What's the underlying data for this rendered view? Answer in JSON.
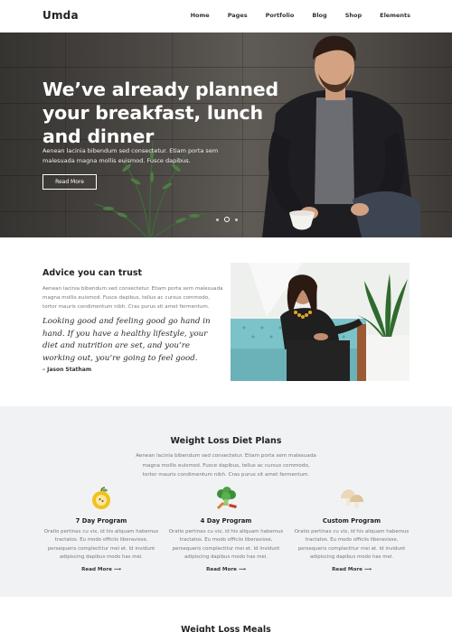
{
  "header": {
    "logo": "Umda",
    "nav": [
      "Home",
      "Pages",
      "Portfolio",
      "Blog",
      "Shop",
      "Elements"
    ]
  },
  "hero": {
    "title": "We’ve already planned your breakfast, lunch and dinner",
    "text": "Aenean lacinia bibendum sed consectetur. Etiam porta sem malesuada magna mollis euismod. Fusce dapibus.",
    "button": "Read More",
    "slides_total": 3,
    "slide_active": 2
  },
  "advice": {
    "title": "Advice you can trust",
    "text": "Aenean lacinia bibendum sed consectetur. Etiam porta sem malesuada magna mollis euismod. Fusce dapibus, tellus ac cursus commodo, tortor mauris condimentum nibh. Cras purus sit amet fermentum.",
    "quote": "Looking good and feeling good go hand in hand. If you have a healthy lifestyle, your diet and nutrition are set, and you’re working out, you’re going to feel good.",
    "author": "– Jason Statham"
  },
  "plans": {
    "title": "Weight Loss Diet Plans",
    "text": "Aenean lacinia bibendum sed consectetur. Etiam porta sem malesuada magna mollis euismod. Fusce dapibus, tellus ac cursus commodo, tortor mauris condimentum nibh. Cras purus sit amet fermentum.",
    "items": [
      {
        "icon": "apple-icon",
        "title": "7 Day Program",
        "text": "Oratio pertinax cu vix, id his aliquam habemus tractatos. Eu modo officiis liberavisse, persequeris complectitur mei et. Id invidunt adipiscing dapibus modo has mei.",
        "link": "Read More"
      },
      {
        "icon": "broccoli-icon",
        "title": "4 Day Program",
        "text": "Oratio pertinax cu vix, id his aliquam habemus tractatos. Eu modo officiis liberavisse, persequeris complectitur mei et. Id invidunt adipiscing dapibus modo has mei.",
        "link": "Read More"
      },
      {
        "icon": "mushroom-icon",
        "title": "Custom Program",
        "text": "Oratio pertinax cu vix, id his aliquam habemus tractatos. Eu modo officiis liberavisse, persequeris complectitur mei et. Id invidunt adipiscing dapibus modo has mei.",
        "link": "Read More"
      }
    ]
  },
  "meals": {
    "title": "Weight Loss Meals"
  },
  "colors": {
    "text_dark": "#222222",
    "text_muted": "#777777",
    "section_bg": "#f1f2f3",
    "plant_green": "#3e6b3a",
    "sofa_teal": "#7cc3c9"
  }
}
